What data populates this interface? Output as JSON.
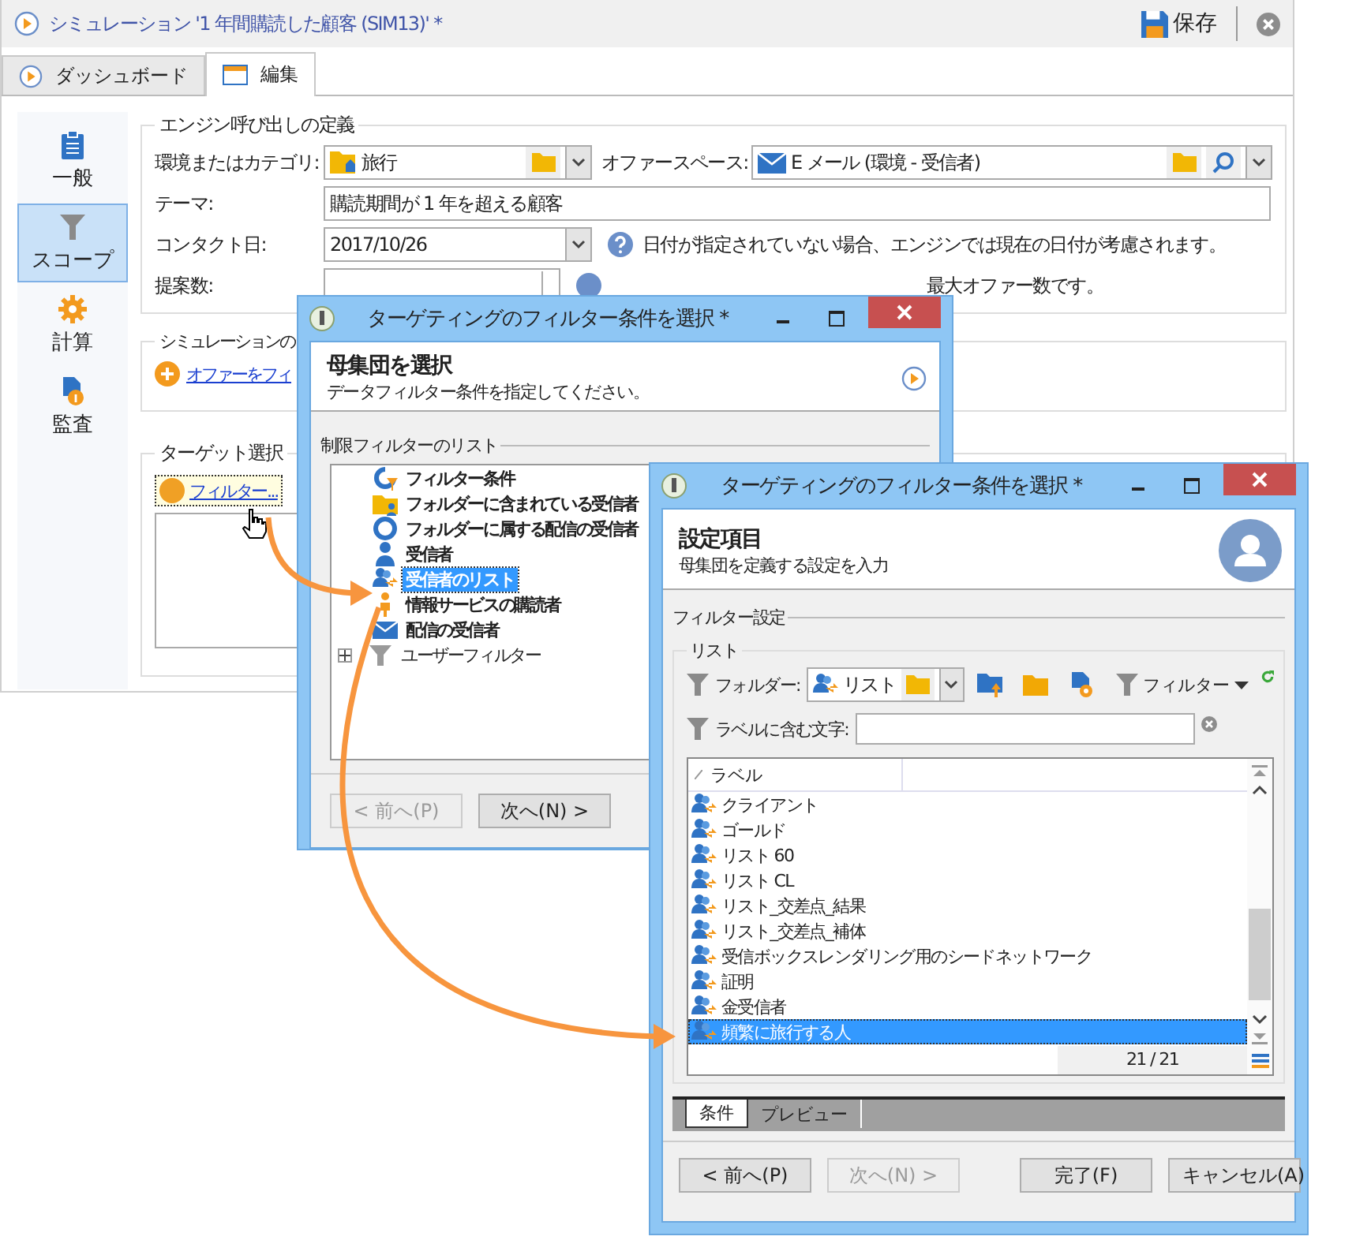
{
  "main_window": {
    "title": "シミュレーション '1 年間購読した顧客 (SIM13)' *",
    "save_label": "保存",
    "tabs": [
      {
        "label": "ダッシュボード",
        "kind": "dashboard",
        "selected": false
      },
      {
        "label": "編集",
        "kind": "edit",
        "selected": true
      }
    ],
    "sidebar": [
      {
        "label": "一般",
        "kind": "general",
        "selected": false
      },
      {
        "label": "スコープ",
        "kind": "scope",
        "selected": true
      },
      {
        "label": "計算",
        "kind": "compute",
        "selected": false
      },
      {
        "label": "監査",
        "kind": "audit",
        "selected": false
      }
    ],
    "engine_section": {
      "title": "エンジン呼び出しの定義",
      "category_label": "環境またはカテゴリ:",
      "category_value": "旅行",
      "space_label": "オファースペース:",
      "space_value": "E メール (環境 - 受信者)",
      "theme_label": "テーマ:",
      "theme_value": "購読期間が 1 年を超える顧客",
      "contact_label": "コンタクト日:",
      "contact_value": "2017/10/26",
      "contact_help": "日付が指定されていない場合、エンジンでは現在の日付が考慮されます。",
      "count_label": "提案数:",
      "count_help": "最大オファー数です。"
    },
    "simulation_section": {
      "title": "シミュレーションの",
      "link": "オファーをフィ"
    },
    "target_section": {
      "title": "ターゲット選択",
      "link": "フィルター..."
    }
  },
  "dialog_1": {
    "title": "ターゲティングのフィルター条件を選択 *",
    "heading": "母集団を選択",
    "subheading": "データフィルター条件を指定してください。",
    "list_title": "制限フィルターのリスト",
    "tree": [
      {
        "label": "フィルター条件",
        "kind": "filter",
        "selected": false
      },
      {
        "label": "フォルダーに含まれている受信者",
        "kind": "folder",
        "selected": false
      },
      {
        "label": "フォルダーに属する配信の受信者",
        "kind": "ring",
        "selected": false
      },
      {
        "label": "受信者",
        "kind": "person",
        "selected": false
      },
      {
        "label": "受信者のリスト",
        "kind": "list",
        "selected": true
      },
      {
        "label": "情報サービスの購読者",
        "kind": "subscriber",
        "selected": false
      },
      {
        "label": "配信の受信者",
        "kind": "delivery",
        "selected": false
      },
      {
        "label": "ユーザーフィルター",
        "kind": "user",
        "selected": false,
        "expanded": false
      }
    ],
    "buttons": [
      {
        "label": "< 前へ(P)",
        "disabled": true
      },
      {
        "label": "次へ(N) >",
        "disabled": false
      }
    ]
  },
  "dialog_2": {
    "title": "ターゲティングのフィルター条件を選択 *",
    "heading": "設定項目",
    "subheading": "母集団を定義する設定を入力",
    "settings_title": "フィルター設定",
    "list_group": "リスト",
    "folder_label": "フォルダー:",
    "folder_value": "リスト",
    "filter_label": "フィルター",
    "label_filter": "ラベルに含む文字:",
    "column": "ラベル",
    "rows": [
      {
        "label": "クライアント",
        "selected": false
      },
      {
        "label": "ゴールド",
        "selected": false
      },
      {
        "label": "リスト 60",
        "selected": false
      },
      {
        "label": "リスト CL",
        "selected": false
      },
      {
        "label": "リスト_交差点_結果",
        "selected": false
      },
      {
        "label": "リスト_交差点_補体",
        "selected": false
      },
      {
        "label": "受信ボックスレンダリング用のシードネットワーク",
        "selected": false
      },
      {
        "label": "証明",
        "selected": false
      },
      {
        "label": "金受信者",
        "selected": false
      },
      {
        "label": "頻繁に旅行する人",
        "selected": true
      }
    ],
    "count": "21 / 21",
    "tabs": [
      {
        "label": "条件",
        "selected": true
      },
      {
        "label": "プレビュー",
        "selected": false
      }
    ],
    "buttons": [
      {
        "label": "< 前へ(P)",
        "disabled": false
      },
      {
        "label": "次へ(N) >",
        "disabled": true
      },
      {
        "label": "完了(F)",
        "disabled": false
      },
      {
        "label": "キャンセル(A)",
        "disabled": false
      }
    ]
  }
}
